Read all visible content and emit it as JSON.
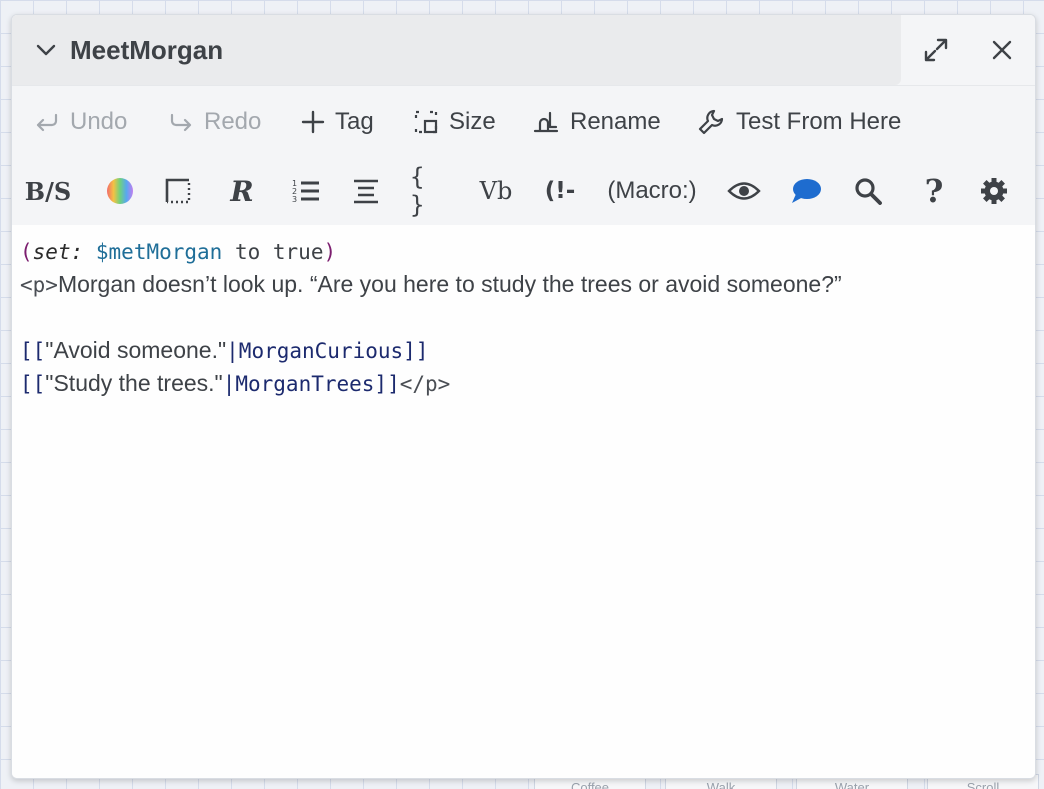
{
  "background": {
    "passages": [
      "Coffee",
      "Walk",
      "Water",
      "Scroll"
    ]
  },
  "dialog": {
    "title": "MeetMorgan",
    "icons": {
      "collapse": "chevron-down-icon",
      "maximize": "maximize-icon",
      "close": "close-icon"
    }
  },
  "toolbar": {
    "undo_label": "Undo",
    "redo_label": "Redo",
    "tag_label": "Tag",
    "size_label": "Size",
    "rename_label": "Rename",
    "test_label": "Test From Here"
  },
  "formatting": {
    "items": [
      {
        "name": "bold-strike-icon",
        "label": "B/S"
      },
      {
        "name": "colour-icon",
        "label": ""
      },
      {
        "name": "border-icon",
        "label": ""
      },
      {
        "name": "special-r-icon",
        "label": "R"
      },
      {
        "name": "list-icon",
        "label": ""
      },
      {
        "name": "align-icon",
        "label": ""
      },
      {
        "name": "braces-icon",
        "label": "{ }"
      },
      {
        "name": "verbatim-icon",
        "label": "Vb"
      },
      {
        "name": "comment-icon",
        "label": "(!-"
      },
      {
        "name": "macro-button",
        "label": "(Macro:)"
      },
      {
        "name": "eye-icon",
        "label": ""
      },
      {
        "name": "speech-bubble-icon",
        "label": ""
      },
      {
        "name": "search-icon",
        "label": ""
      },
      {
        "name": "help-icon",
        "label": "?"
      },
      {
        "name": "gear-icon",
        "label": ""
      }
    ],
    "colors": {
      "accent": "#1e6ccf"
    }
  },
  "code": {
    "line1": {
      "open": "(",
      "macro": "set:",
      "var": "$metMorgan",
      "rest": " to true",
      "close": ")"
    },
    "line2": {
      "tag": "<p>",
      "text": "Morgan doesn’t look up. “Are you here to study the trees or avoid someone?”"
    },
    "line4": {
      "open": "[[",
      "text": "\"Avoid someone.\"",
      "target": "|MorganCurious]]"
    },
    "line5": {
      "open": "[[",
      "text": "\"Study the trees.\"",
      "target": "|MorganTrees]]",
      "tag": "</p>"
    }
  }
}
